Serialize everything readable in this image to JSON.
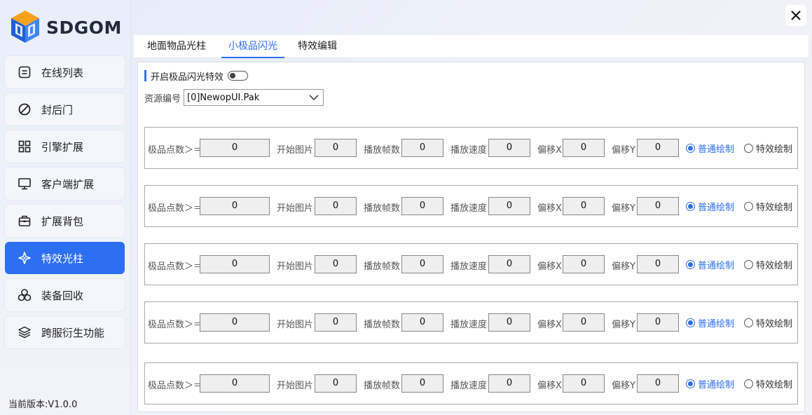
{
  "app": {
    "logo_text": "SDGOM",
    "version": "当前版本:V1.0.0",
    "accent": "#2c6ff0"
  },
  "sidebar": {
    "items": [
      {
        "label": "在线列表",
        "icon": "list-icon"
      },
      {
        "label": "封后门",
        "icon": "ban-icon"
      },
      {
        "label": "引擎扩展",
        "icon": "grid-icon"
      },
      {
        "label": "客户端扩展",
        "icon": "monitor-icon"
      },
      {
        "label": "扩展背包",
        "icon": "briefcase-icon"
      },
      {
        "label": "特效光柱",
        "icon": "sparkle-icon",
        "active": true
      },
      {
        "label": "装备回收",
        "icon": "recycle-icon"
      },
      {
        "label": "跨服衍生功能",
        "icon": "layers-icon"
      }
    ]
  },
  "tabs": [
    {
      "label": "地面物品光柱"
    },
    {
      "label": "小极品闪光",
      "active": true
    },
    {
      "label": "特效编辑"
    }
  ],
  "panel": {
    "enable_label": "开启极品闪光特效",
    "enable_on": false,
    "resource_label": "资源编号",
    "resource_value": "[0]NewopUI.Pak"
  },
  "field_labels": {
    "points": "极品点数＞＝",
    "start_image": "开始图片",
    "frames": "播放帧数",
    "speed": "播放速度",
    "offset_x": "偏移X",
    "offset_y": "偏移Y",
    "normal_draw": "普通绘制",
    "effect_draw": "特效绘制"
  },
  "rows": [
    {
      "points": "0",
      "start_image": "0",
      "frames": "0",
      "speed": "0",
      "offset_x": "0",
      "offset_y": "0",
      "mode": "normal"
    },
    {
      "points": "0",
      "start_image": "0",
      "frames": "0",
      "speed": "0",
      "offset_x": "0",
      "offset_y": "0",
      "mode": "normal"
    },
    {
      "points": "0",
      "start_image": "0",
      "frames": "0",
      "speed": "0",
      "offset_x": "0",
      "offset_y": "0",
      "mode": "normal"
    },
    {
      "points": "0",
      "start_image": "0",
      "frames": "0",
      "speed": "0",
      "offset_x": "0",
      "offset_y": "0",
      "mode": "normal"
    },
    {
      "points": "0",
      "start_image": "0",
      "frames": "0",
      "speed": "0",
      "offset_x": "0",
      "offset_y": "0",
      "mode": "normal"
    }
  ]
}
